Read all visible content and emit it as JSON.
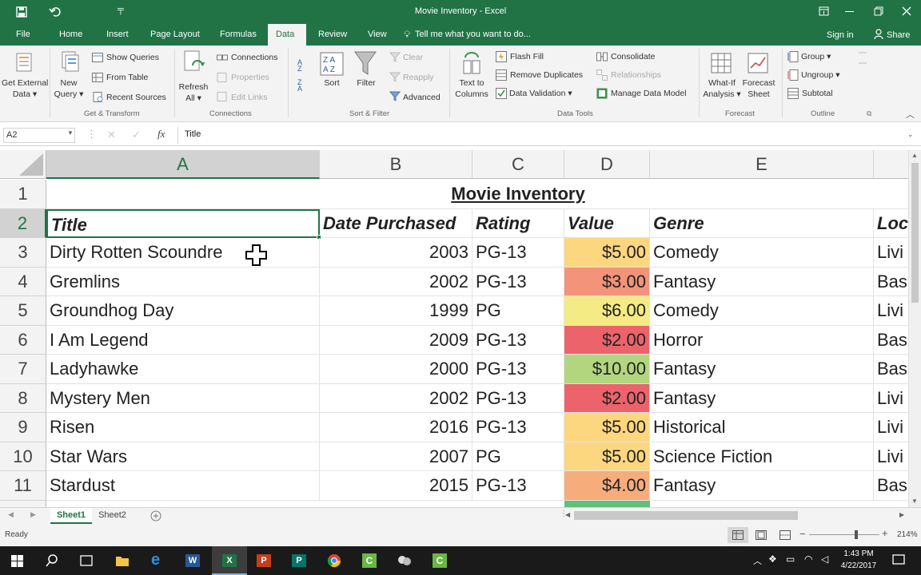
{
  "window": {
    "title": "Movie Inventory - Excel"
  },
  "tabs": {
    "file": "File",
    "home": "Home",
    "insert": "Insert",
    "page_layout": "Page Layout",
    "formulas": "Formulas",
    "data": "Data",
    "review": "Review",
    "view": "View",
    "tell_me": "Tell me what you want to do...",
    "sign_in": "Sign in",
    "share": "Share"
  },
  "ribbon": {
    "get_external_data": "Get External",
    "get_external_data2": "Data ▾",
    "new_query": "New",
    "new_query2": "Query ▾",
    "show_queries": "Show Queries",
    "from_table": "From Table",
    "recent_sources": "Recent Sources",
    "refresh_all": "Refresh",
    "refresh_all2": "All ▾",
    "connections": "Connections",
    "properties": "Properties",
    "edit_links": "Edit Links",
    "sort": "Sort",
    "filter": "Filter",
    "clear": "Clear",
    "reapply": "Reapply",
    "advanced": "Advanced",
    "text_to_columns": "Text to",
    "text_to_columns2": "Columns",
    "flash_fill": "Flash Fill",
    "remove_duplicates": "Remove Duplicates",
    "data_validation": "Data Validation ▾",
    "consolidate": "Consolidate",
    "relationships": "Relationships",
    "manage_data_model": "Manage Data Model",
    "what_if": "What-If",
    "what_if2": "Analysis ▾",
    "forecast_sheet": "Forecast",
    "forecast_sheet2": "Sheet",
    "group": "Group ▾",
    "ungroup": "Ungroup ▾",
    "subtotal": "Subtotal",
    "groups": {
      "get_transform": "Get & Transform",
      "connections": "Connections",
      "sort_filter": "Sort & Filter",
      "data_tools": "Data Tools",
      "forecast": "Forecast",
      "outline": "Outline"
    }
  },
  "formula_bar": {
    "name_box": "A2",
    "fx": "fx",
    "content": "Title"
  },
  "sheet": {
    "columns": [
      "A",
      "B",
      "C",
      "D",
      "E"
    ],
    "title": "Movie Inventory",
    "headers": {
      "a": "Title",
      "b": "Date Purchased",
      "c": "Rating",
      "d": "Value",
      "e": "Genre",
      "f": "Loc"
    },
    "rows": [
      {
        "num": "1"
      },
      {
        "num": "2"
      },
      {
        "num": "3",
        "title": "Dirty Rotten Scoundre",
        "year": "2003",
        "rating": "PG-13",
        "value": "$5.00",
        "genre": "Comedy",
        "loc": "Livi",
        "color": "#fdd780"
      },
      {
        "num": "4",
        "title": "Gremlins",
        "year": "2002",
        "rating": "PG-13",
        "value": "$3.00",
        "genre": "Fantasy",
        "loc": "Bas",
        "color": "#f2937a"
      },
      {
        "num": "5",
        "title": "Groundhog Day",
        "year": "1999",
        "rating": "PG",
        "value": "$6.00",
        "genre": "Comedy",
        "loc": "Livi",
        "color": "#f4eb84"
      },
      {
        "num": "6",
        "title": "I Am Legend",
        "year": "2009",
        "rating": "PG-13",
        "value": "$2.00",
        "genre": "Horror",
        "loc": "Bas",
        "color": "#ec636b"
      },
      {
        "num": "7",
        "title": "Ladyhawke",
        "year": "2000",
        "rating": "PG-13",
        "value": "$10.00",
        "genre": "Fantasy",
        "loc": "Bas",
        "color": "#b2d680"
      },
      {
        "num": "8",
        "title": "Mystery Men",
        "year": "2002",
        "rating": "PG-13",
        "value": "$2.00",
        "genre": "Fantasy",
        "loc": "Livi",
        "color": "#ec636b"
      },
      {
        "num": "9",
        "title": "Risen",
        "year": "2016",
        "rating": "PG-13",
        "value": "$5.00",
        "genre": "Historical",
        "loc": "Livi",
        "color": "#fdd780"
      },
      {
        "num": "10",
        "title": "Star Wars",
        "year": "2007",
        "rating": "PG",
        "value": "$5.00",
        "genre": "Science Fiction",
        "loc": "Livi",
        "color": "#fdd780"
      },
      {
        "num": "11",
        "title": "Stardust",
        "year": "2015",
        "rating": "PG-13",
        "value": "$4.00",
        "genre": "Fantasy",
        "loc": "Bas",
        "color": "#f7ac7c"
      }
    ]
  },
  "sheet_tabs": [
    "Sheet1",
    "Sheet2"
  ],
  "status": {
    "ready": "Ready",
    "zoom": "214%"
  },
  "taskbar": {
    "time": "1:43 PM",
    "date": "4/22/2017"
  },
  "colors": {
    "excel_green": "#217346",
    "ribbon_bg": "#f3f3f3"
  }
}
